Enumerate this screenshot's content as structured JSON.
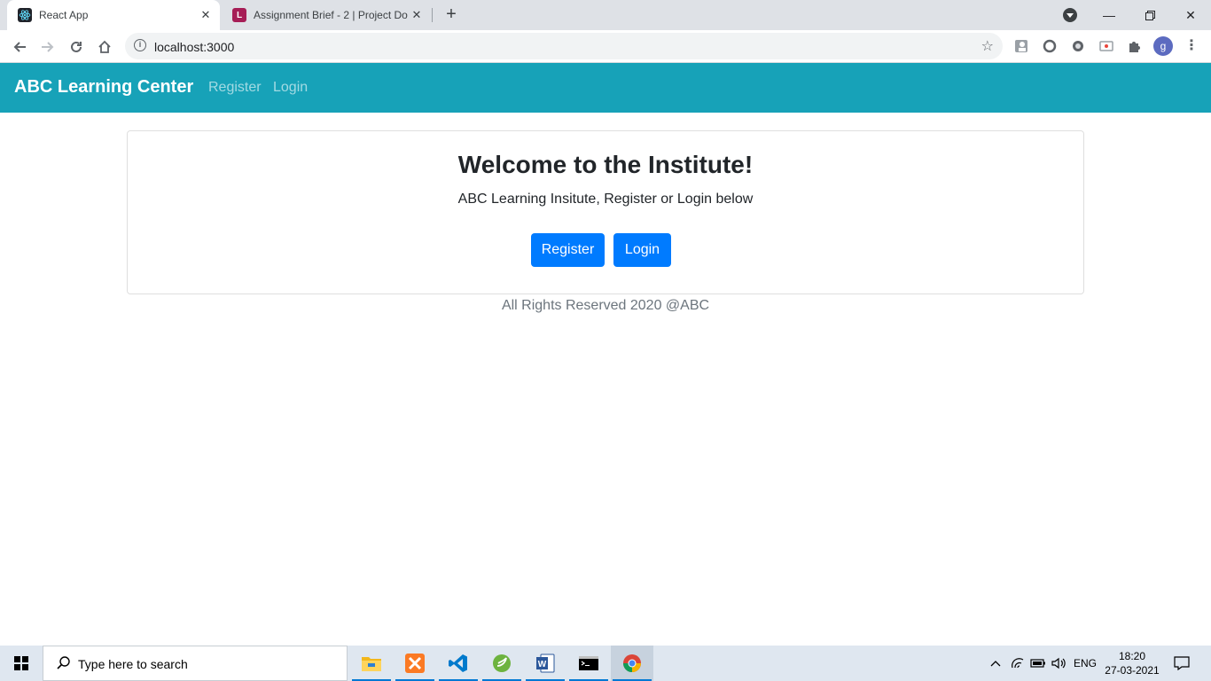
{
  "browser": {
    "tabs": [
      {
        "title": "React App",
        "active": true
      },
      {
        "title": "Assignment Brief - 2 | Project Do",
        "active": false
      }
    ],
    "url": "localhost:3000",
    "profile_initial": "g"
  },
  "app": {
    "brand": "ABC Learning Center",
    "nav": {
      "register": "Register",
      "login": "Login"
    },
    "card": {
      "heading": "Welcome to the Institute!",
      "subtext": "ABC Learning Insitute, Register or Login below",
      "register_button": "Register",
      "login_button": "Login"
    },
    "footer": "All Rights Reserved 2020 @ABC"
  },
  "taskbar": {
    "search_placeholder": "Type here to search",
    "language": "ENG",
    "time": "18:20",
    "date": "27-03-2021"
  },
  "colors": {
    "navbar": "#17a2b8",
    "primary_button": "#007bff"
  }
}
